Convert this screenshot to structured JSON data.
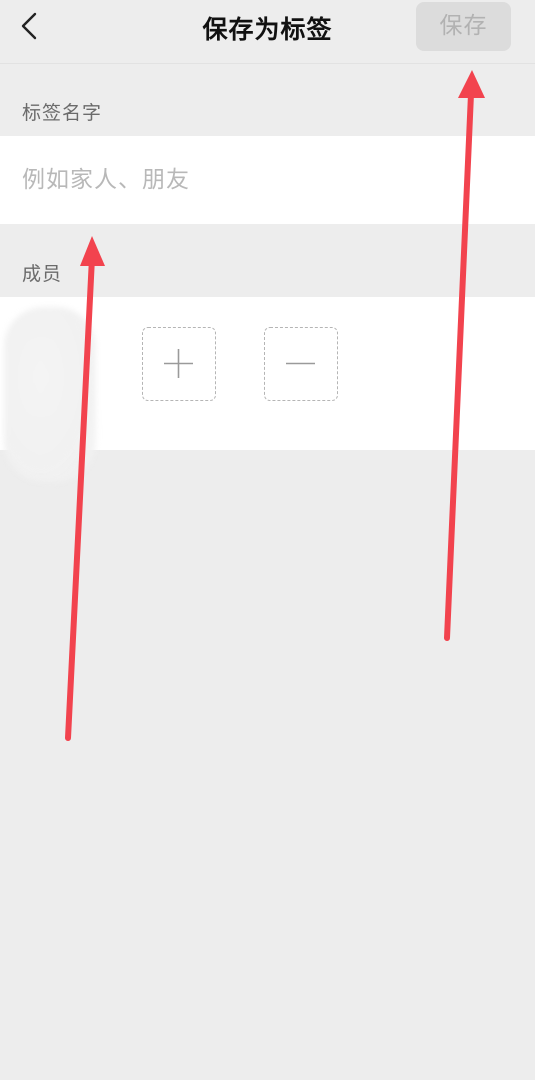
{
  "header": {
    "back_icon": "chevron-left-icon",
    "title": "保存为标签",
    "save_label": "保存"
  },
  "tag_name": {
    "label": "标签名字",
    "placeholder": "例如家人、朋友"
  },
  "members": {
    "label": "成员",
    "add_icon": "plus-icon",
    "remove_icon": "minus-icon"
  },
  "annotation_color": "#f2434e"
}
